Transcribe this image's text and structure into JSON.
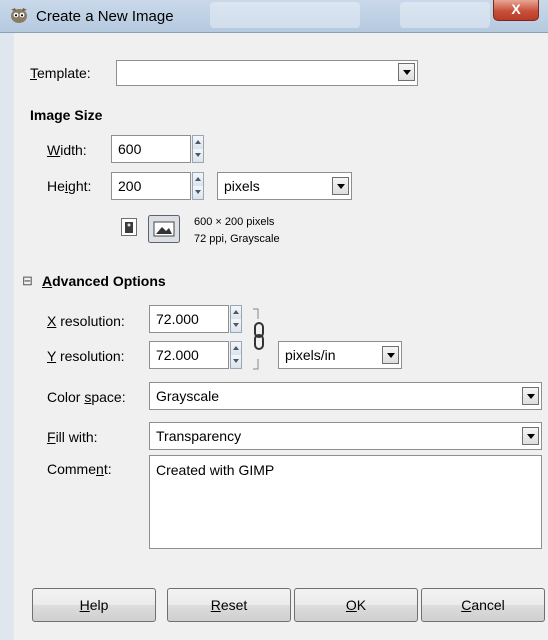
{
  "window": {
    "title": "Create a New Image",
    "close_label": "X"
  },
  "template": {
    "label_mnemonic": "T",
    "label_rest": "emplate:",
    "value": ""
  },
  "image_size": {
    "heading": "Image Size",
    "width_mnemonic": "W",
    "width_rest": "idth:",
    "width_value": "600",
    "height_pre": "He",
    "height_mnemonic": "i",
    "height_rest": "ght:",
    "height_value": "200",
    "unit": "pixels",
    "info_line1": "600 × 200 pixels",
    "info_line2": "72 ppi, Grayscale"
  },
  "advanced": {
    "toggle": "⊟",
    "heading_mnemonic": "A",
    "heading_rest": "dvanced Options",
    "xres_mnemonic": "X",
    "xres_rest": " resolution:",
    "xres_value": "72.000",
    "yres_mnemonic": "Y",
    "yres_rest": " resolution:",
    "yres_value": "72.000",
    "res_unit": "pixels/in",
    "colorspace_pre": "Color ",
    "colorspace_mnemonic": "s",
    "colorspace_rest": "pace:",
    "colorspace_value": "Grayscale",
    "fill_mnemonic": "F",
    "fill_rest": "ill with:",
    "fill_value": "Transparency",
    "comment_pre": "Comme",
    "comment_mnemonic": "n",
    "comment_rest": "t:",
    "comment_value": "Created with GIMP"
  },
  "buttons": {
    "help_mnemonic": "H",
    "help_rest": "elp",
    "reset_mnemonic": "R",
    "reset_rest": "eset",
    "ok_mnemonic": "O",
    "ok_rest": "K",
    "cancel_mnemonic": "C",
    "cancel_rest": "ancel"
  }
}
